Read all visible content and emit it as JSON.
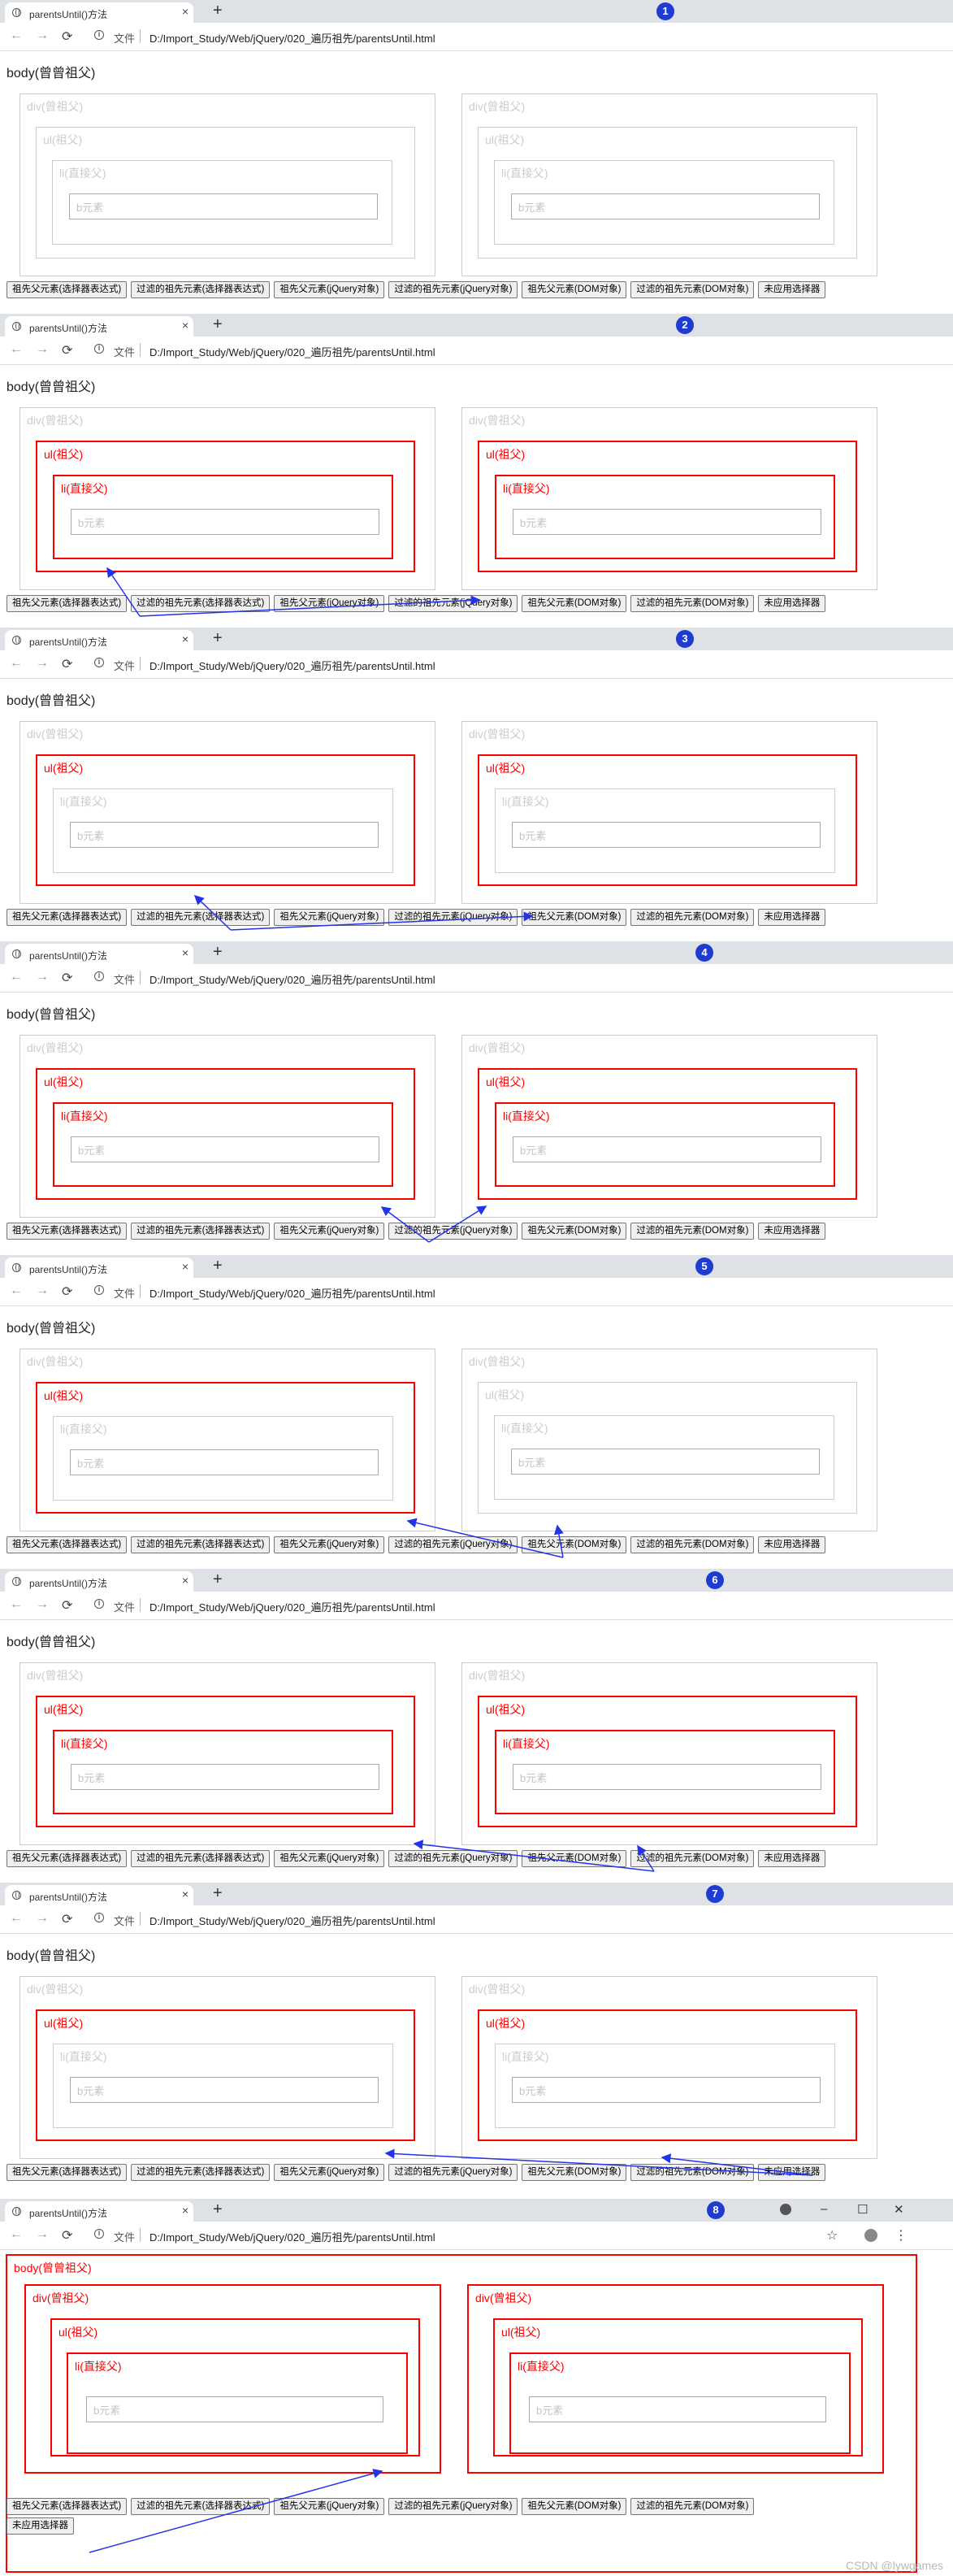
{
  "tab_title": "parentsUntil()方法",
  "new_tab_label": "+",
  "tab_close_label": "×",
  "address": {
    "scheme_label": "文件",
    "url": "D:/Import_Study/Web/jQuery/020_遍历祖先/parentsUntil.html"
  },
  "labels": {
    "body": "body(曾曾祖父)",
    "div": "div(曾祖父)",
    "ul": "ul(祖父)",
    "li": "li(直接父)",
    "b": "b元素"
  },
  "buttons": [
    "祖先父元素(选择器表达式)",
    "过滤的祖先元素(选择器表达式)",
    "祖先父元素(jQuery对象)",
    "过滤的祖先元素(jQuery对象)",
    "祖先父元素(DOM对象)",
    "过滤的祖先元素(DOM对象)",
    "未应用选择器"
  ],
  "steps": [
    {
      "badge": "1",
      "highlight": {
        "body": false,
        "div": [
          false,
          false
        ],
        "ul": [
          false,
          false
        ],
        "li": [
          false,
          false
        ]
      }
    },
    {
      "badge": "2",
      "highlight": {
        "body": false,
        "div": [
          false,
          false
        ],
        "ul": [
          true,
          true
        ],
        "li": [
          true,
          true
        ]
      }
    },
    {
      "badge": "3",
      "highlight": {
        "body": false,
        "div": [
          false,
          false
        ],
        "ul": [
          true,
          true
        ],
        "li": [
          false,
          false
        ]
      }
    },
    {
      "badge": "4",
      "highlight": {
        "body": false,
        "div": [
          false,
          false
        ],
        "ul": [
          true,
          true
        ],
        "li": [
          true,
          true
        ]
      }
    },
    {
      "badge": "5",
      "highlight": {
        "body": false,
        "div": [
          false,
          false
        ],
        "ul": [
          true,
          false
        ],
        "li": [
          false,
          false
        ]
      }
    },
    {
      "badge": "6",
      "highlight": {
        "body": false,
        "div": [
          false,
          false
        ],
        "ul": [
          true,
          true
        ],
        "li": [
          true,
          true
        ]
      }
    },
    {
      "badge": "7",
      "highlight": {
        "body": false,
        "div": [
          false,
          false
        ],
        "ul": [
          true,
          true
        ],
        "li": [
          false,
          false
        ]
      }
    },
    {
      "badge": "8",
      "highlight": {
        "body": true,
        "div": [
          true,
          true
        ],
        "ul": [
          true,
          true
        ],
        "li": [
          true,
          true
        ]
      }
    }
  ],
  "window_controls": [
    "–",
    "☐",
    "✕"
  ],
  "watermark": "CSDN @lywgames",
  "colors": {
    "highlight": "#ff0000",
    "arrow": "#2233e8",
    "badge": "#1e3ccf",
    "inactive_border": "#cccccc"
  },
  "icons": [
    "globe-icon",
    "back-icon",
    "forward-icon",
    "reload-icon",
    "info-icon",
    "star-icon",
    "avatar-icon",
    "menu-icon"
  ]
}
